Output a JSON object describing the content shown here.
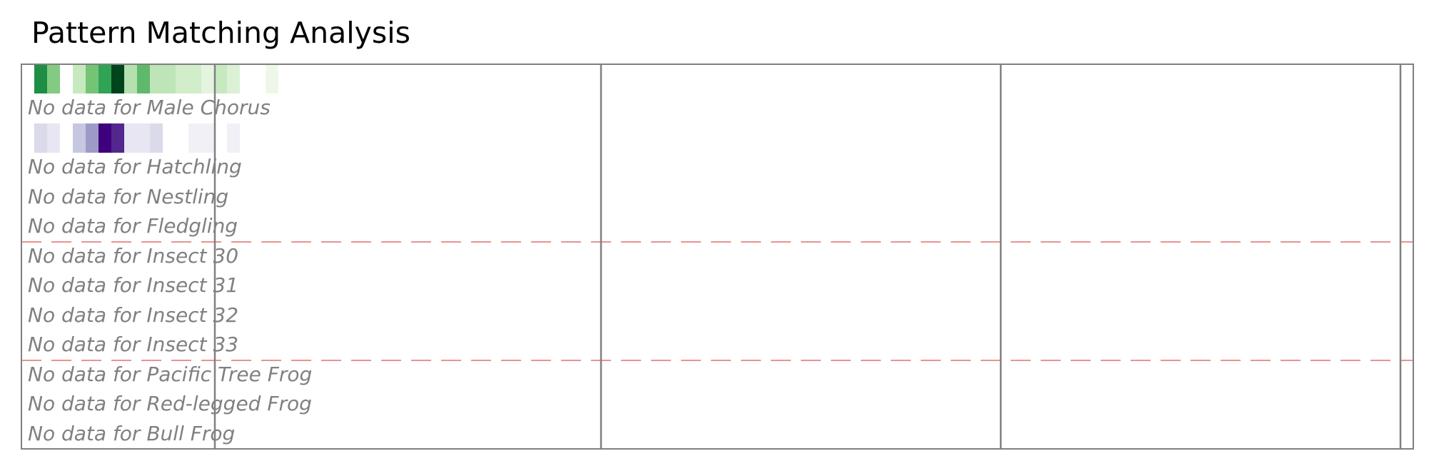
{
  "title": "Pattern Matching Analysis",
  "chart_data": {
    "type": "heatmap",
    "title": "Pattern Matching Analysis",
    "rows": [
      {
        "label": "Male Chorus",
        "has_data": false,
        "message": "No data for Male Chorus"
      },
      {
        "label": "Hatchling",
        "has_data": false,
        "message": "No data for Hatchling"
      },
      {
        "label": "Nestling",
        "has_data": false,
        "message": "No data for Nestling"
      },
      {
        "label": "Fledgling",
        "has_data": false,
        "message": "No data for Fledgling"
      },
      {
        "label": "Insect 30",
        "has_data": false,
        "message": "No data for Insect 30"
      },
      {
        "label": "Insect 31",
        "has_data": false,
        "message": "No data for Insect 31"
      },
      {
        "label": "Insect 32",
        "has_data": false,
        "message": "No data for Insect 32"
      },
      {
        "label": "Insect 33",
        "has_data": false,
        "message": "No data for Insect 33"
      },
      {
        "label": "Pacific Tree Frog",
        "has_data": false,
        "message": "No data for Pacific Tree Frog"
      },
      {
        "label": "Red-legged Frog",
        "has_data": false,
        "message": "No data for Red-legged Frog"
      },
      {
        "label": "Bull Frog",
        "has_data": false,
        "message": "No data for Bull Frog"
      }
    ],
    "heat_strips": [
      {
        "colormap": "Greens",
        "values": [
          0.8,
          0.55,
          0.0,
          0.25,
          0.6,
          0.75,
          1.0,
          0.35,
          0.65,
          0.3,
          0.3,
          0.2,
          0.2,
          0.1,
          0.25,
          0.15,
          0.0,
          0.0,
          0.05
        ]
      },
      {
        "colormap": "Purples",
        "values": [
          0.15,
          0.1,
          0.0,
          0.25,
          0.45,
          1.0,
          0.85,
          0.1,
          0.1,
          0.15,
          0.0,
          0.0,
          0.06,
          0.06,
          0.0,
          0.06
        ]
      }
    ],
    "group_separators_after_row": [
      3,
      7
    ],
    "column_dividers": 4,
    "colors": {
      "separator": "#e07070",
      "frame": "#808080",
      "message_text": "#808080"
    },
    "grid": false,
    "legend": "none"
  }
}
